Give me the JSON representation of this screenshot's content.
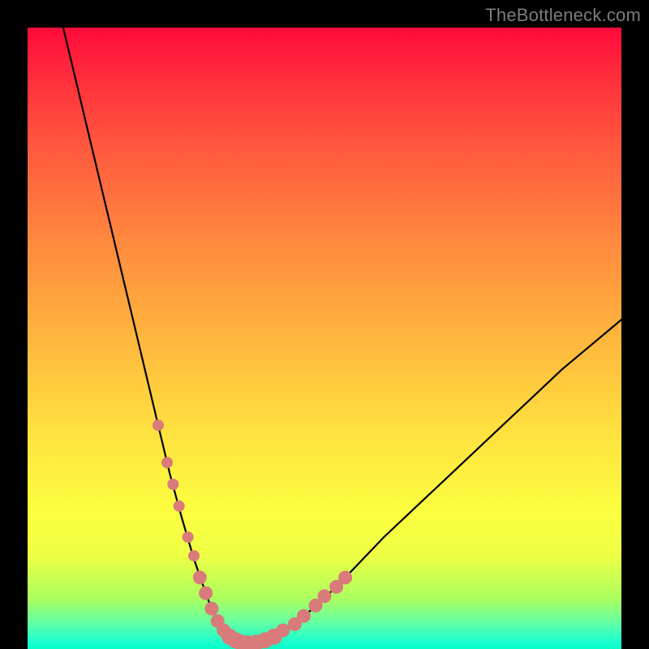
{
  "watermark": "TheBottleneck.com",
  "colors": {
    "background": "#000000",
    "curve": "#000000",
    "marker_fill": "#d87b7a",
    "gradient_top": "#ff0a3a",
    "gradient_bottom": "#07ffc8"
  },
  "chart_data": {
    "type": "line",
    "title": "",
    "xlabel": "",
    "ylabel": "",
    "xlim": [
      0,
      100
    ],
    "ylim": [
      0,
      100
    ],
    "grid": false,
    "legend": false,
    "series": [
      {
        "name": "curve",
        "x": [
          6,
          8,
          10,
          12,
          14,
          16,
          18,
          20,
          22,
          24,
          26,
          28,
          30,
          31,
          32,
          33,
          34,
          35,
          36,
          38,
          40,
          42,
          45,
          48,
          52,
          56,
          60,
          65,
          70,
          75,
          80,
          85,
          90,
          95,
          100
        ],
        "y": [
          100,
          92,
          84,
          76,
          68,
          60,
          52,
          44,
          36,
          28,
          21,
          14.5,
          9,
          6.5,
          4.5,
          3,
          2,
          1.4,
          1,
          0.9,
          1.3,
          2.2,
          4,
          6.5,
          10,
          14,
          18,
          22.5,
          27,
          31.5,
          36,
          40.5,
          45,
          49,
          53
        ]
      }
    ],
    "markers": {
      "name": "highlighted-points",
      "color": "#d87b7a",
      "points_xy": [
        [
          22,
          36
        ],
        [
          23.5,
          30
        ],
        [
          24.5,
          26.5
        ],
        [
          25.5,
          23
        ],
        [
          27,
          18
        ],
        [
          28,
          15
        ],
        [
          29,
          11.5
        ],
        [
          30,
          9
        ],
        [
          31,
          6.5
        ],
        [
          32,
          4.5
        ],
        [
          33,
          3
        ],
        [
          34,
          2
        ],
        [
          35,
          1.4
        ],
        [
          36,
          1
        ],
        [
          37,
          0.9
        ],
        [
          38.5,
          1
        ],
        [
          40,
          1.4
        ],
        [
          41.5,
          2
        ],
        [
          43,
          3
        ],
        [
          45,
          4
        ],
        [
          46.5,
          5.3
        ],
        [
          48.5,
          7
        ],
        [
          50,
          8.5
        ],
        [
          52,
          10
        ],
        [
          53.5,
          11.5
        ]
      ]
    }
  }
}
